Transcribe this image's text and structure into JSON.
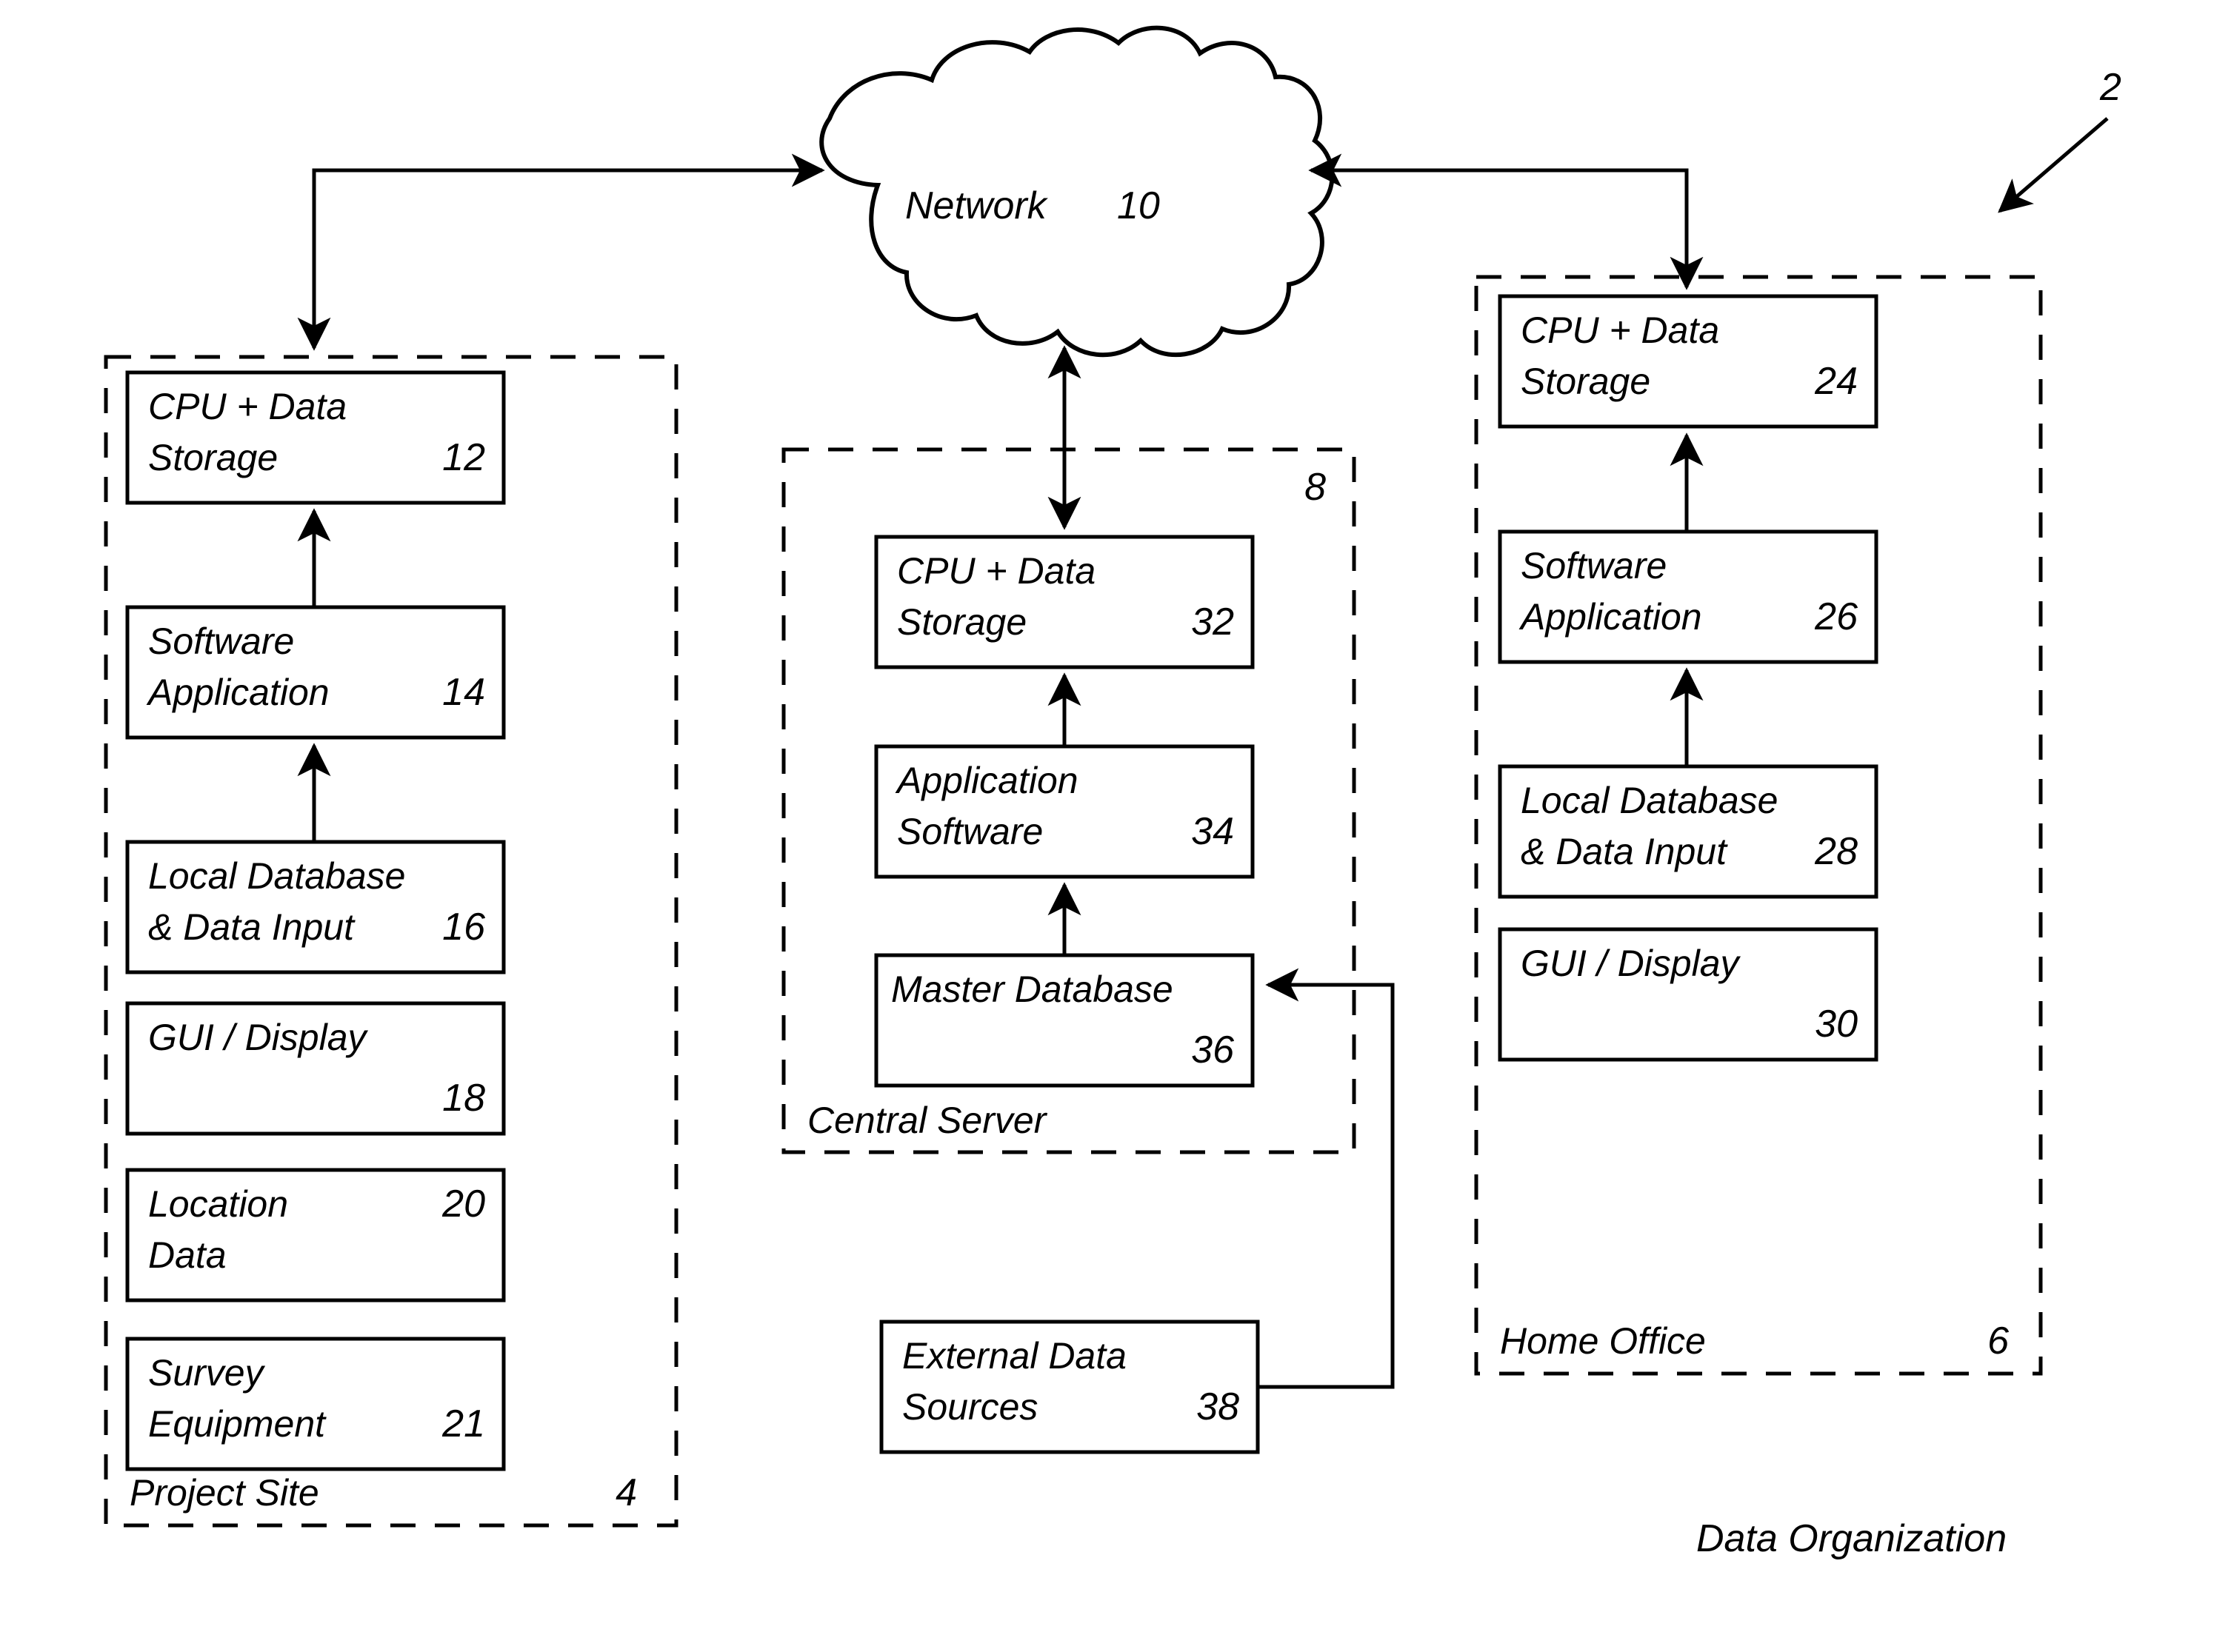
{
  "figure": {
    "caption": "Data Organization",
    "figure_ref": "2"
  },
  "network": {
    "label": "Network",
    "ref": "10"
  },
  "groups": {
    "project_site": {
      "label": "Project Site",
      "ref": "4",
      "boxes": [
        {
          "line1": "CPU + Data",
          "line2": "Storage",
          "ref": "12",
          "ref_line": 2
        },
        {
          "line1": "Software",
          "line2": "Application",
          "ref": "14",
          "ref_line": 2
        },
        {
          "line1": "Local Database",
          "line2": "& Data Input",
          "ref": "16",
          "ref_line": 2
        },
        {
          "line1": "GUI / Display",
          "line2": "",
          "ref": "18",
          "ref_line": 2
        },
        {
          "line1": "Location",
          "line2": "Data",
          "ref": "20",
          "ref_line": 1
        },
        {
          "line1": "Survey",
          "line2": "Equipment",
          "ref": "21",
          "ref_line": 2
        }
      ]
    },
    "central_server": {
      "label": "Central Server",
      "ref": "8",
      "boxes": [
        {
          "line1": "CPU + Data",
          "line2": "Storage",
          "ref": "32",
          "ref_line": 2
        },
        {
          "line1": "Application",
          "line2": "Software",
          "ref": "34",
          "ref_line": 2
        },
        {
          "line1": "Master Database",
          "line2": "",
          "ref": "36",
          "ref_line": 2
        }
      ]
    },
    "home_office": {
      "label": "Home Office",
      "ref": "6",
      "boxes": [
        {
          "line1": "CPU + Data",
          "line2": "Storage",
          "ref": "24",
          "ref_line": 2
        },
        {
          "line1": "Software",
          "line2": "Application",
          "ref": "26",
          "ref_line": 2
        },
        {
          "line1": "Local Database",
          "line2": "& Data Input",
          "ref": "28",
          "ref_line": 2
        },
        {
          "line1": "GUI / Display",
          "line2": "",
          "ref": "30",
          "ref_line": 2
        }
      ]
    }
  },
  "external": {
    "box": {
      "line1": "External Data",
      "line2": "Sources",
      "ref": "38",
      "ref_line": 2
    }
  },
  "colors": {
    "ink": "#000000",
    "paper": "#ffffff"
  }
}
